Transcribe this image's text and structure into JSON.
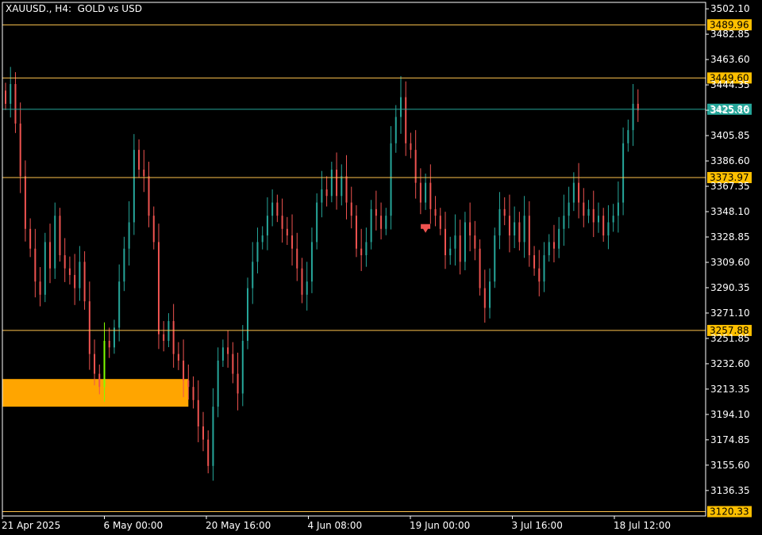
{
  "header": {
    "symbol_timeframe": "XAUUSD., H4:",
    "description": "GOLD vs USD"
  },
  "colors": {
    "background": "#000000",
    "axis": "#ffffff",
    "bull": "#26a69a",
    "bear": "#ef5350",
    "level_line": "#ffc44d",
    "level_label_bg": "#ffc000",
    "current_price_bg": "#26a69a",
    "zone_fill": "#ffa500",
    "zone_candle": "#7fff00"
  },
  "chart_data": {
    "type": "candlestick",
    "symbol": "XAUUSD.",
    "timeframe": "H4",
    "ylim": [
      3117.0,
      3507.0
    ],
    "y_ticks": [
      "3502.10",
      "3482.85",
      "3463.60",
      "3444.35",
      "3425.10",
      "3405.85",
      "3386.60",
      "3367.35",
      "3348.10",
      "3328.85",
      "3309.60",
      "3290.35",
      "3271.10",
      "3251.85",
      "3232.60",
      "3213.35",
      "3194.10",
      "3174.85",
      "3155.60",
      "3136.35"
    ],
    "x_ticks": [
      "21 Apr 2025",
      "6 May 00:00",
      "20 May 16:00",
      "4 Jun 08:00",
      "19 Jun 00:00",
      "3 Jul 16:00",
      "18 Jul 12:00"
    ],
    "price_levels": [
      {
        "label": "3489.96",
        "value": 3489.96
      },
      {
        "label": "3449.60",
        "value": 3449.6
      },
      {
        "label": "3373.97",
        "value": 3373.97
      },
      {
        "label": "3257.88",
        "value": 3257.88
      },
      {
        "label": "3120.33",
        "value": 3120.33
      }
    ],
    "current_price": {
      "label": "3425.86",
      "value": 3425.86
    },
    "zone": {
      "from_bar": 0,
      "to_bar": 37,
      "low": 3200.0,
      "high": 3221.0
    },
    "signal_arrow": {
      "bar": 85,
      "price": 3335,
      "direction": "down"
    },
    "close_series": [
      3430,
      3445,
      3415,
      3375,
      3335,
      3320,
      3295,
      3285,
      3325,
      3305,
      3345,
      3315,
      3305,
      3300,
      3290,
      3310,
      3280,
      3240,
      3225,
      3215,
      3250,
      3245,
      3260,
      3295,
      3320,
      3340,
      3395,
      3380,
      3375,
      3345,
      3325,
      3255,
      3250,
      3265,
      3240,
      3235,
      3220,
      3215,
      3205,
      3185,
      3175,
      3155,
      3200,
      3235,
      3245,
      3240,
      3225,
      3210,
      3250,
      3290,
      3310,
      3325,
      3330,
      3345,
      3355,
      3345,
      3335,
      3330,
      3320,
      3305,
      3285,
      3295,
      3325,
      3355,
      3365,
      3360,
      3380,
      3360,
      3375,
      3355,
      3345,
      3320,
      3315,
      3325,
      3350,
      3345,
      3335,
      3345,
      3400,
      3420,
      3435,
      3400,
      3395,
      3370,
      3355,
      3370,
      3350,
      3345,
      3335,
      3315,
      3320,
      3330,
      3310,
      3340,
      3330,
      3320,
      3290,
      3275,
      3295,
      3330,
      3350,
      3345,
      3330,
      3340,
      3325,
      3345,
      3315,
      3305,
      3295,
      3315,
      3325,
      3320,
      3335,
      3345,
      3355,
      3370,
      3355,
      3345,
      3350,
      3340,
      3345,
      3330,
      3340,
      3345,
      3355,
      3400,
      3410,
      3430,
      3425
    ]
  }
}
